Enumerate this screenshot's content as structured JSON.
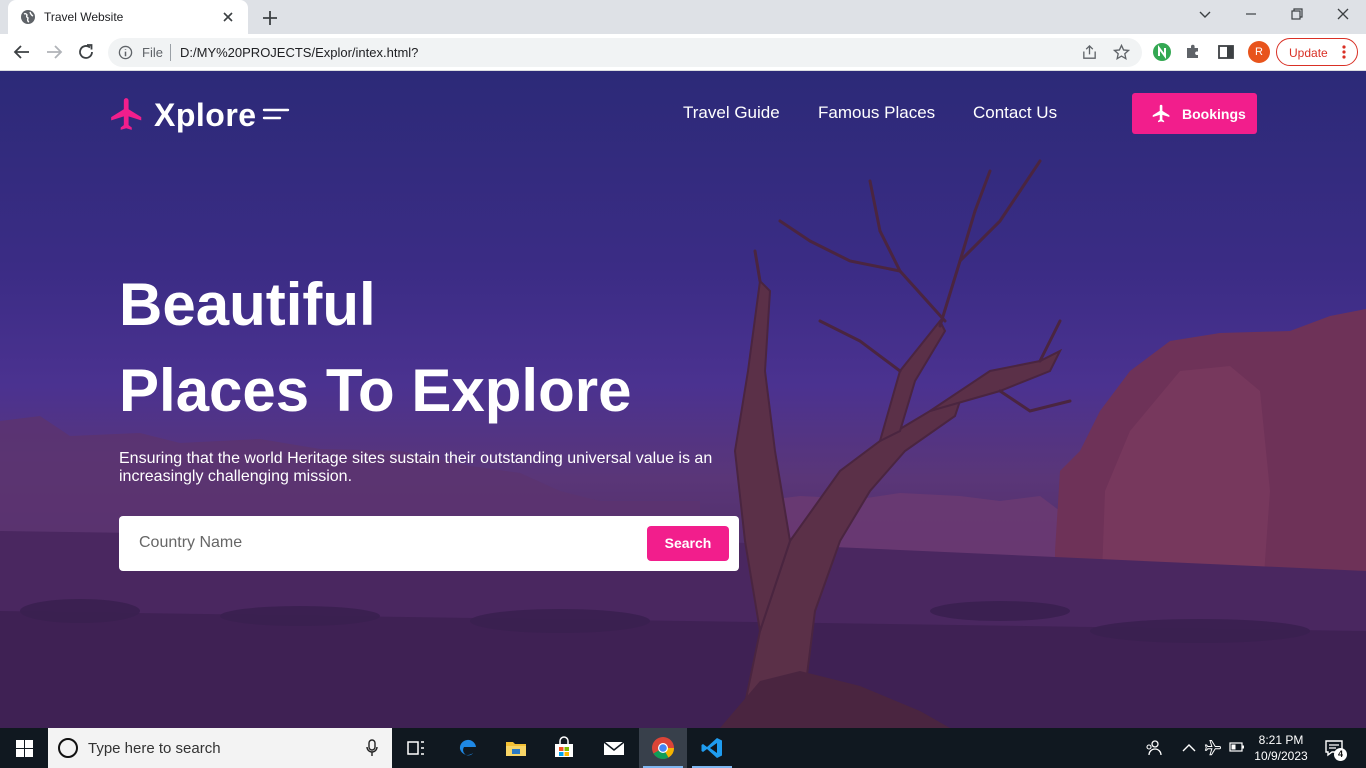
{
  "browser": {
    "tab_title": "Travel Website",
    "omnibox": {
      "scheme_label": "File",
      "url": "D:/MY%20PROJECTS/Explor/intex.html?"
    },
    "profile_initial": "R",
    "update_label": "Update"
  },
  "site": {
    "brand": "Xplore",
    "nav": [
      "Travel Guide",
      "Famous Places",
      "Contact Us"
    ],
    "bookings_label": "Bookings",
    "headline": [
      "Beautiful",
      "Places To Explore"
    ],
    "subtext": "Ensuring that the world Heritage sites sustain their outstanding universal value is an increasingly challenging mission.",
    "search": {
      "placeholder": "Country Name",
      "value": "",
      "button_label": "Search"
    },
    "colors": {
      "accent": "#f21e8c",
      "overlay": "#3b2c85"
    }
  },
  "taskbar": {
    "search_placeholder": "Type here to search",
    "apps": [
      "task-view",
      "edge",
      "file-explorer",
      "store",
      "mail",
      "chrome",
      "vscode"
    ],
    "active_app": "chrome",
    "clock": {
      "time": "8:21 PM",
      "date": "10/9/2023"
    },
    "notification_count": "4"
  }
}
